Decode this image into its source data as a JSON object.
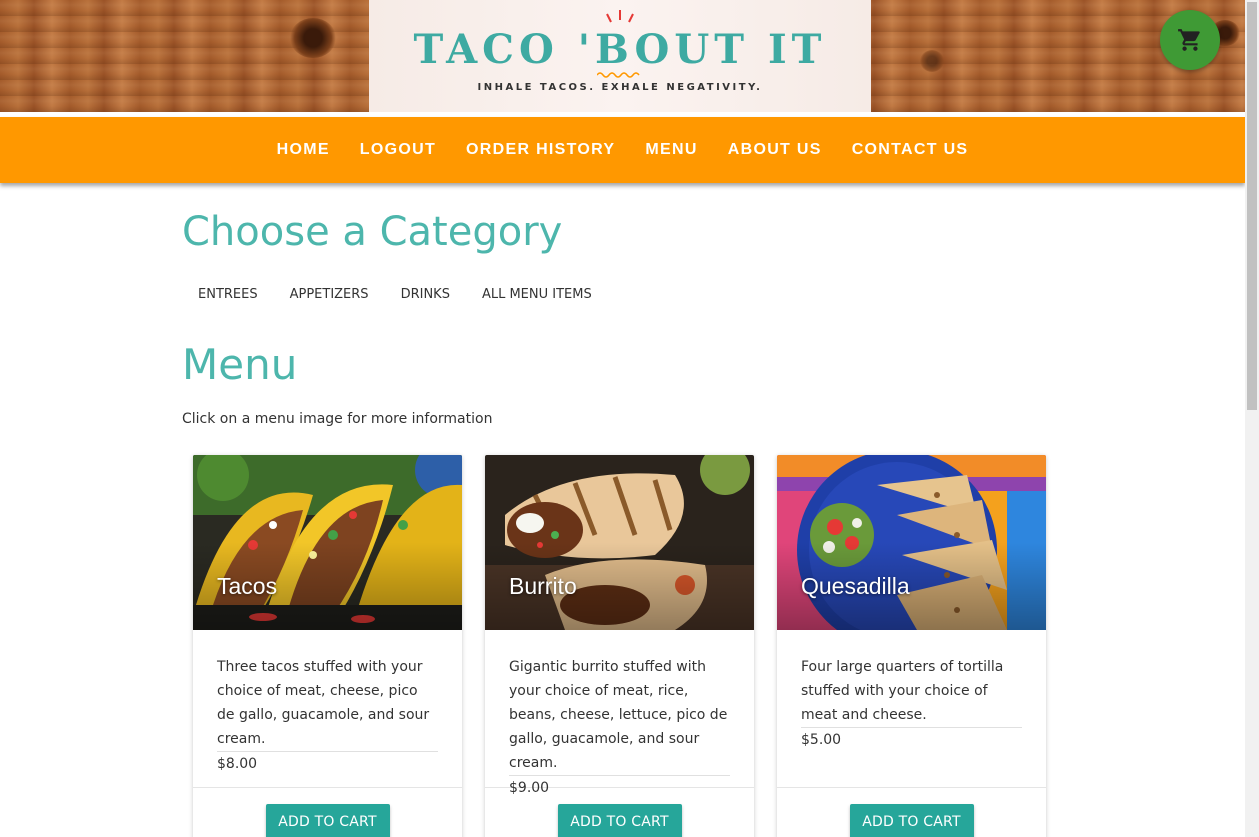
{
  "header": {
    "logo_title": "TACO 'BOUT IT",
    "logo_tagline": "INHALE TACOS. EXHALE NEGATIVITY.",
    "cart_icon": "cart-icon"
  },
  "nav": {
    "items": [
      {
        "label": "HOME"
      },
      {
        "label": "LOGOUT"
      },
      {
        "label": "ORDER HISTORY"
      },
      {
        "label": "MENU"
      },
      {
        "label": "ABOUT US"
      },
      {
        "label": "CONTACT US"
      }
    ]
  },
  "category": {
    "title": "Choose a Category",
    "tabs": [
      {
        "label": "ENTREES"
      },
      {
        "label": "APPETIZERS"
      },
      {
        "label": "DRINKS"
      },
      {
        "label": "ALL MENU ITEMS"
      }
    ]
  },
  "menu": {
    "title": "Menu",
    "info": "Click on a menu image for more information",
    "items": [
      {
        "name": "Tacos",
        "description": "Three tacos stuffed with your choice of meat, cheese, pico de gallo, guacamole, and sour cream.",
        "price": "$8.00",
        "button": "ADD TO CART"
      },
      {
        "name": "Burrito",
        "description": "Gigantic burrito stuffed with your choice of meat, rice, beans, cheese, lettuce, pico de gallo, guacamole, and sour cream.",
        "price": "$9.00",
        "button": "ADD TO CART"
      },
      {
        "name": "Quesadilla",
        "description": "Four large quarters of tortilla stuffed with your choice of meat and cheese.",
        "price": "$5.00",
        "button": "ADD TO CART"
      }
    ]
  },
  "colors": {
    "accent": "#4db6ac",
    "nav_bg": "#ff9800",
    "button": "#26a69a",
    "cart": "#3f9a35"
  }
}
